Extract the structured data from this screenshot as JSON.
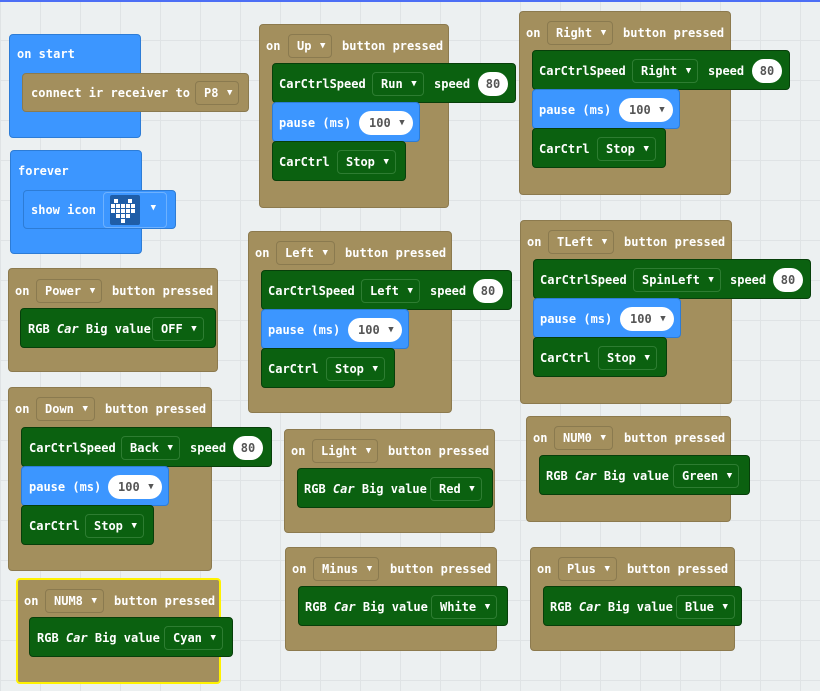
{
  "caret": "▼",
  "on_start": {
    "title": "on start",
    "connect_label": "connect ir receiver to",
    "pin": "P8"
  },
  "forever": {
    "title": "forever",
    "show_icon_label": "show icon",
    "icon": "heart-icon"
  },
  "labels": {
    "on": "on",
    "button_pressed": "button pressed",
    "carctrlspeed": "CarCtrlSpeed",
    "speed": "speed",
    "pause_ms": "pause (ms)",
    "carctrl": "CarCtrl",
    "rgb": "RGB",
    "car": "Car",
    "big_value": "Big value"
  },
  "handlers": {
    "power": {
      "button": "Power",
      "rgb_value": "OFF"
    },
    "down": {
      "button": "Down",
      "dir": "Back",
      "speed": "80",
      "pause": "100",
      "ctrl": "Stop"
    },
    "num8": {
      "button": "NUM8",
      "rgb_value": "Cyan"
    },
    "up": {
      "button": "Up",
      "dir": "Run",
      "speed": "80",
      "pause": "100",
      "ctrl": "Stop"
    },
    "left": {
      "button": "Left",
      "dir": "Left",
      "speed": "80",
      "pause": "100",
      "ctrl": "Stop"
    },
    "light": {
      "button": "Light",
      "rgb_value": "Red"
    },
    "minus": {
      "button": "Minus",
      "rgb_value": "White"
    },
    "right": {
      "button": "Right",
      "dir": "Right",
      "speed": "80",
      "pause": "100",
      "ctrl": "Stop"
    },
    "tleft": {
      "button": "TLeft",
      "dir": "SpinLeft",
      "speed": "80",
      "pause": "100",
      "ctrl": "Stop"
    },
    "num0": {
      "button": "NUM0",
      "rgb_value": "Green"
    },
    "plus": {
      "button": "Plus",
      "rgb_value": "Blue"
    }
  },
  "colors": {
    "blue": "#3c96ff",
    "olive": "#a38f5d",
    "green": "#0b6110",
    "selected_outline": "#fff200"
  }
}
